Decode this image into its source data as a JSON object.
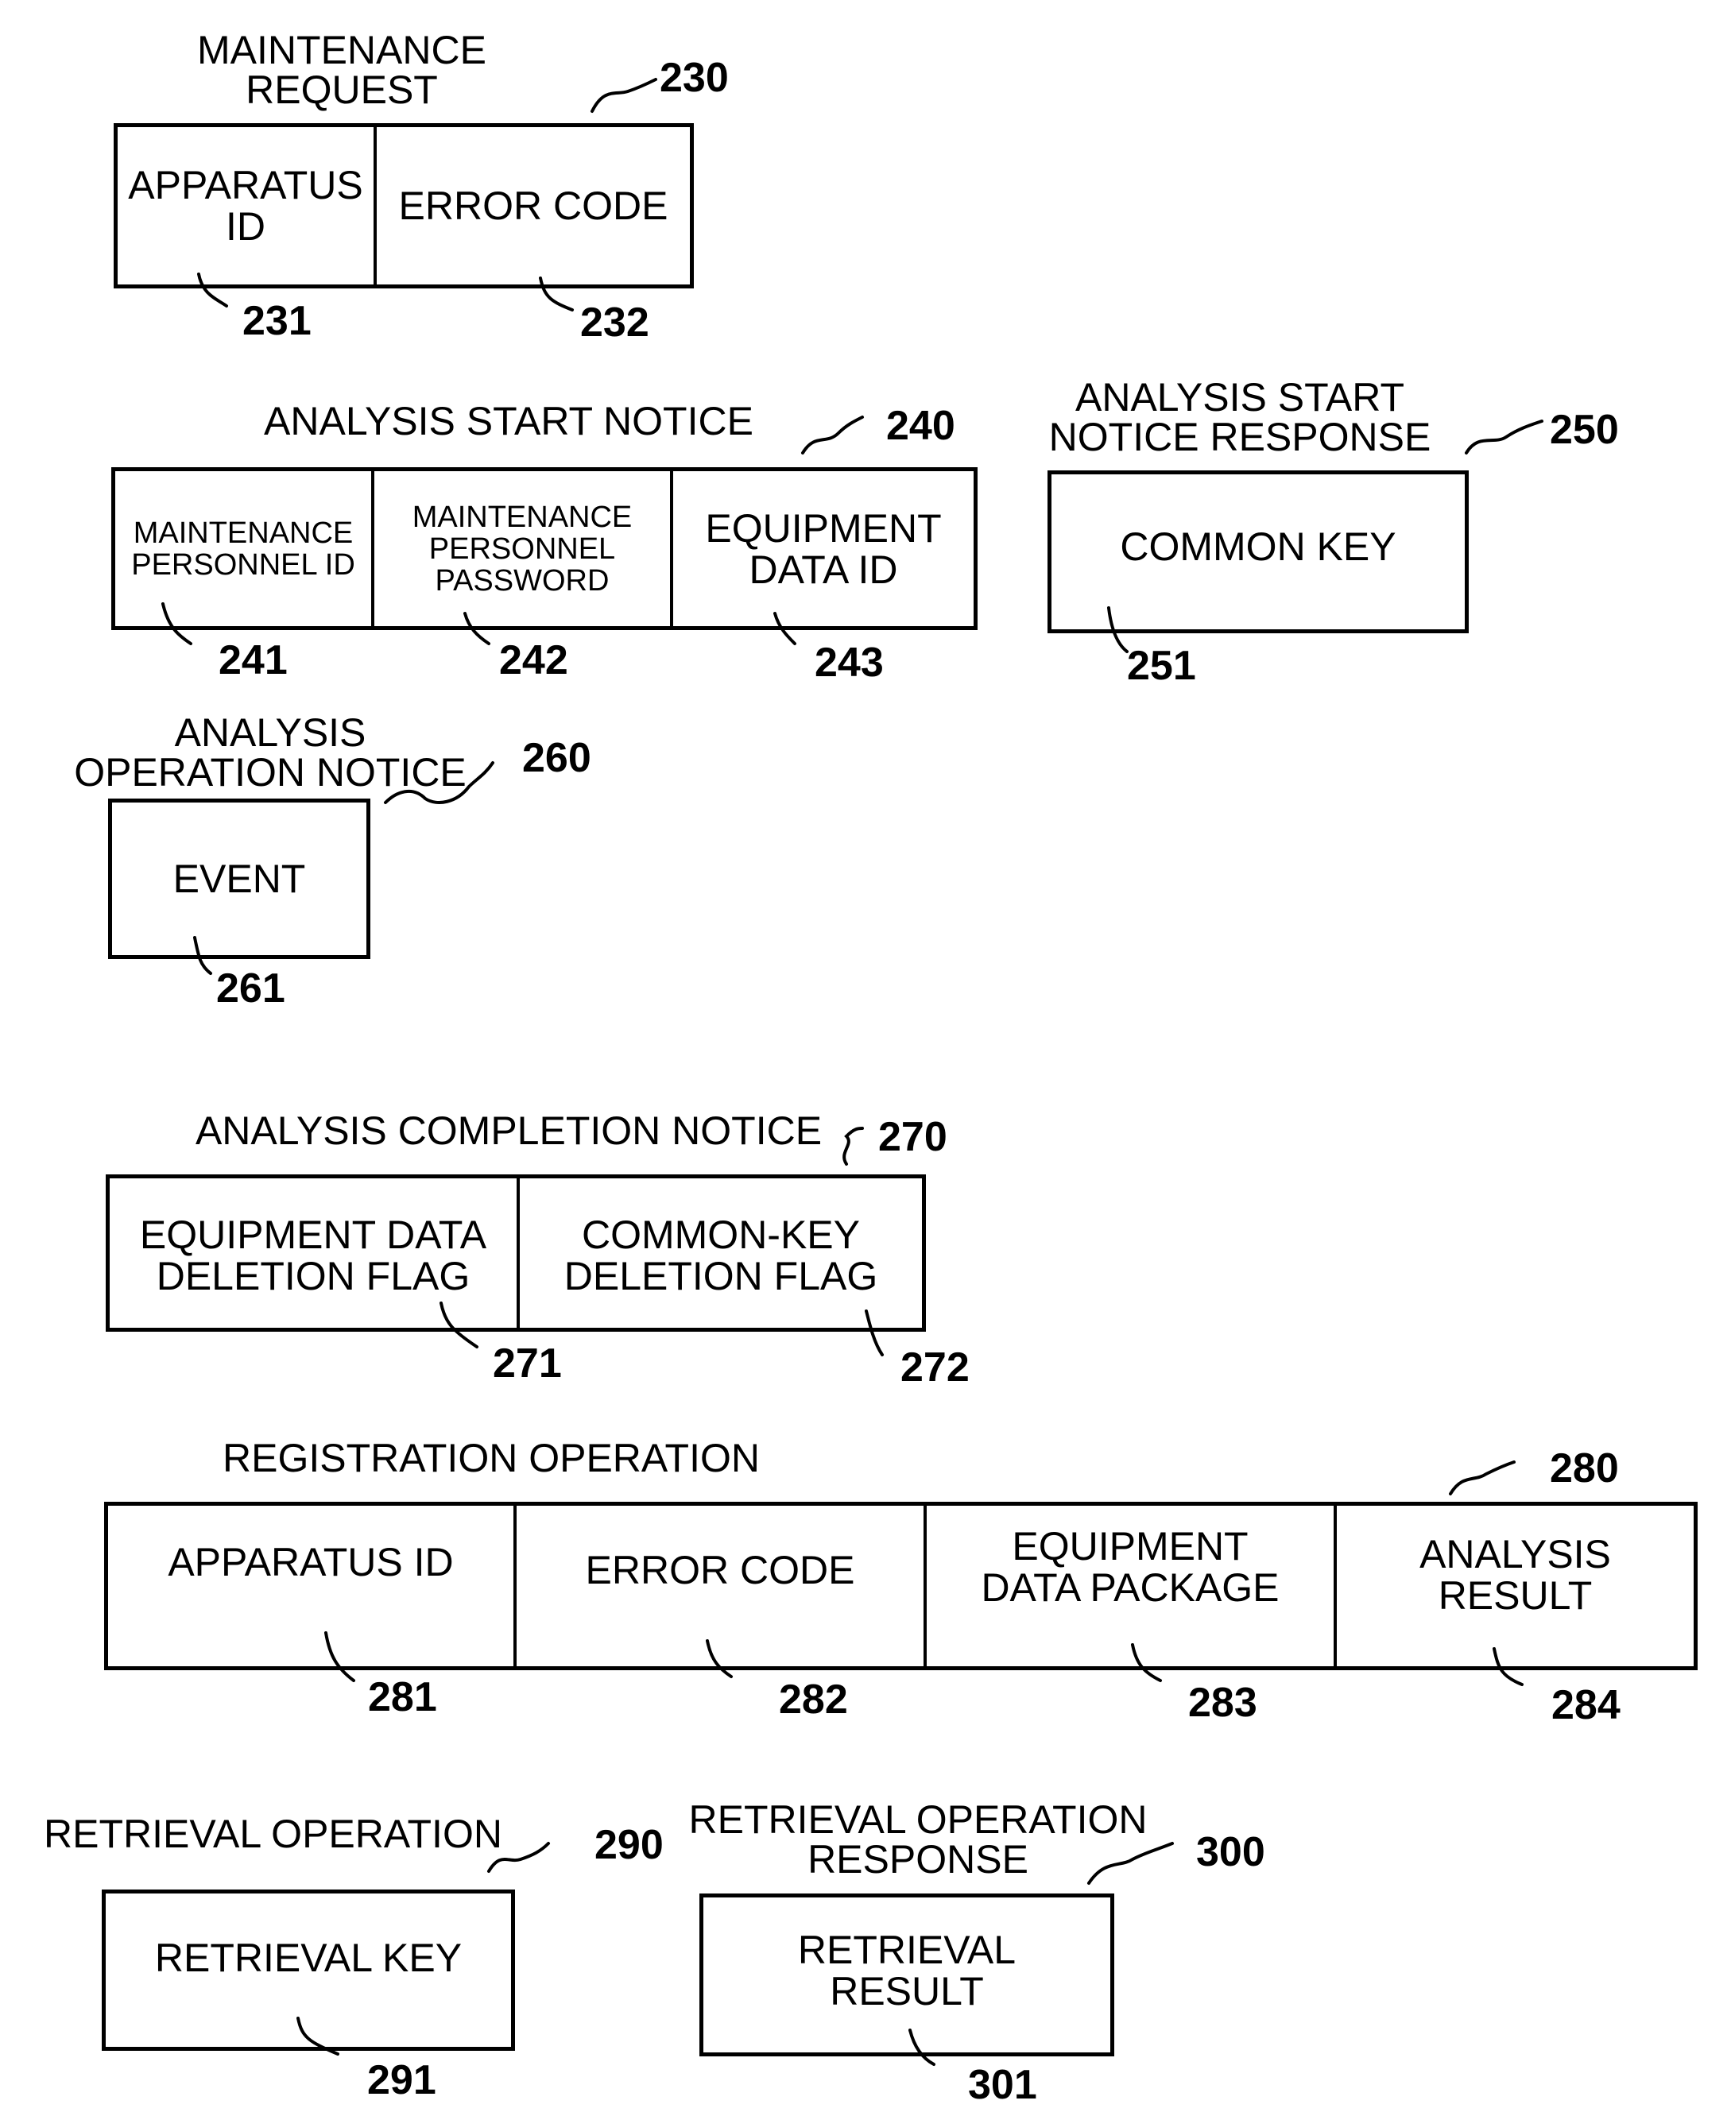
{
  "figure": {
    "messages": [
      {
        "id": "maintenance-request",
        "title": "MAINTENANCE\nREQUEST",
        "ref": "230",
        "fields": [
          {
            "label": "APPARATUS\nID",
            "ref": "231"
          },
          {
            "label": "ERROR CODE",
            "ref": "232"
          }
        ]
      },
      {
        "id": "analysis-start-notice",
        "title": "ANALYSIS START NOTICE",
        "ref": "240",
        "fields": [
          {
            "label": "MAINTENANCE\nPERSONNEL ID",
            "ref": "241"
          },
          {
            "label": "MAINTENANCE\nPERSONNEL\nPASSWORD",
            "ref": "242"
          },
          {
            "label": "EQUIPMENT\nDATA ID",
            "ref": "243"
          }
        ]
      },
      {
        "id": "analysis-start-notice-response",
        "title": "ANALYSIS START\nNOTICE RESPONSE",
        "ref": "250",
        "fields": [
          {
            "label": "COMMON KEY",
            "ref": "251"
          }
        ]
      },
      {
        "id": "analysis-operation-notice",
        "title": "ANALYSIS\nOPERATION NOTICE",
        "ref": "260",
        "fields": [
          {
            "label": "EVENT",
            "ref": "261"
          }
        ]
      },
      {
        "id": "analysis-completion-notice",
        "title": "ANALYSIS COMPLETION NOTICE",
        "ref": "270",
        "fields": [
          {
            "label": "EQUIPMENT DATA\nDELETION FLAG",
            "ref": "271"
          },
          {
            "label": "COMMON-KEY\nDELETION FLAG",
            "ref": "272"
          }
        ]
      },
      {
        "id": "registration-operation",
        "title": "REGISTRATION OPERATION",
        "ref": "280",
        "fields": [
          {
            "label": "APPARATUS ID",
            "ref": "281"
          },
          {
            "label": "ERROR CODE",
            "ref": "282"
          },
          {
            "label": "EQUIPMENT\nDATA PACKAGE",
            "ref": "283"
          },
          {
            "label": "ANALYSIS\nRESULT",
            "ref": "284"
          }
        ]
      },
      {
        "id": "retrieval-operation",
        "title": "RETRIEVAL OPERATION",
        "ref": "290",
        "fields": [
          {
            "label": "RETRIEVAL KEY",
            "ref": "291"
          }
        ]
      },
      {
        "id": "retrieval-operation-response",
        "title": "RETRIEVAL OPERATION\nRESPONSE",
        "ref": "300",
        "fields": [
          {
            "label": "RETRIEVAL\nRESULT",
            "ref": "301"
          }
        ]
      }
    ]
  }
}
